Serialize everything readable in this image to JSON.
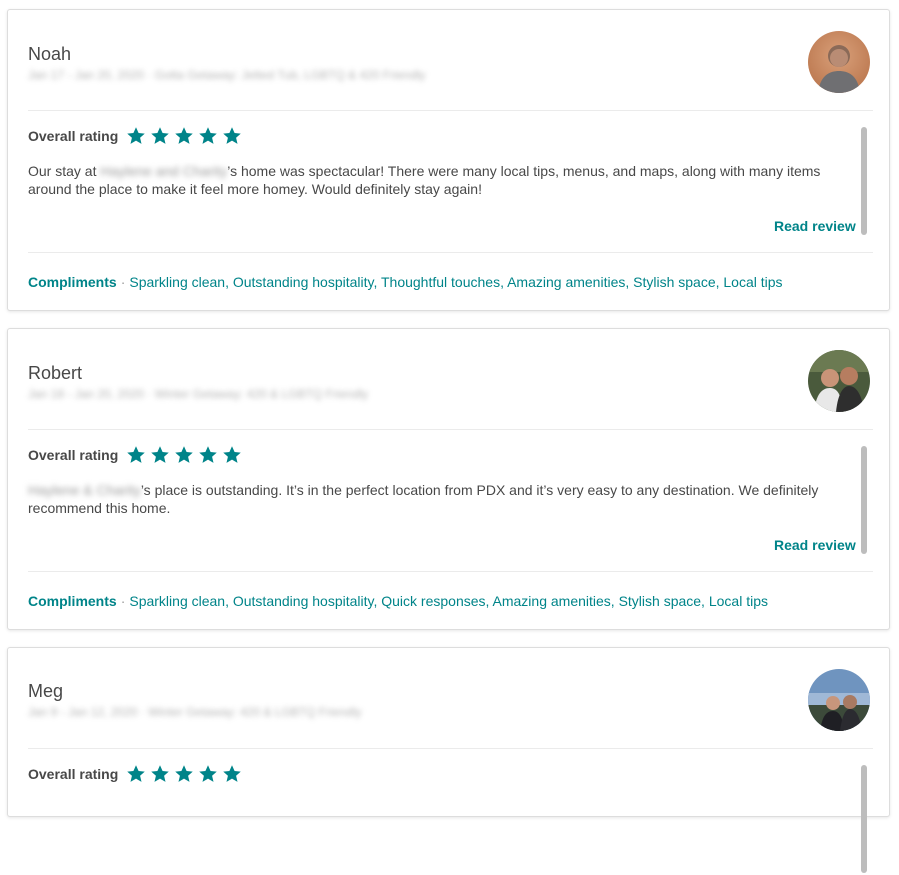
{
  "reviews": [
    {
      "name": "Noah",
      "meta": "Jan 17 - Jan 20, 2020 · Gotta Getaway: Jetted Tub, LGBTQ & 420 Friendly",
      "rating_label": "Overall rating",
      "stars": 5,
      "text_before": "Our stay at ",
      "host_name": "Haylene and Charity",
      "text_after": "’s home was spectacular! There were many local tips, menus, and maps, along with many items around the place to make it feel more homey. Would definitely stay again!",
      "read_review": "Read review",
      "compliments_label": "Compliments",
      "compliments": "Sparkling clean, Outstanding hospitality, Thoughtful touches, Amazing amenities, Stylish space, Local tips"
    },
    {
      "name": "Robert",
      "meta": "Jan 18 - Jan 20, 2020 · Winter Getaway: 420 & LGBTQ Friendly",
      "rating_label": "Overall rating",
      "stars": 5,
      "text_before": "",
      "host_name": "Haylene & Charity",
      "text_after": "’s place is outstanding. It’s in the perfect location from PDX and it’s very easy to any destination. We definitely recommend this home.",
      "read_review": "Read review",
      "compliments_label": "Compliments",
      "compliments": "Sparkling clean, Outstanding hospitality, Quick responses, Amazing amenities, Stylish space, Local tips"
    },
    {
      "name": "Meg",
      "meta": "Jan 9 - Jan 12, 2020 · Winter Getaway: 420 & LGBTQ Friendly",
      "rating_label": "Overall rating",
      "stars": 5
    }
  ],
  "colors": {
    "accent": "#008489",
    "text": "#484848",
    "star": "#008489"
  }
}
